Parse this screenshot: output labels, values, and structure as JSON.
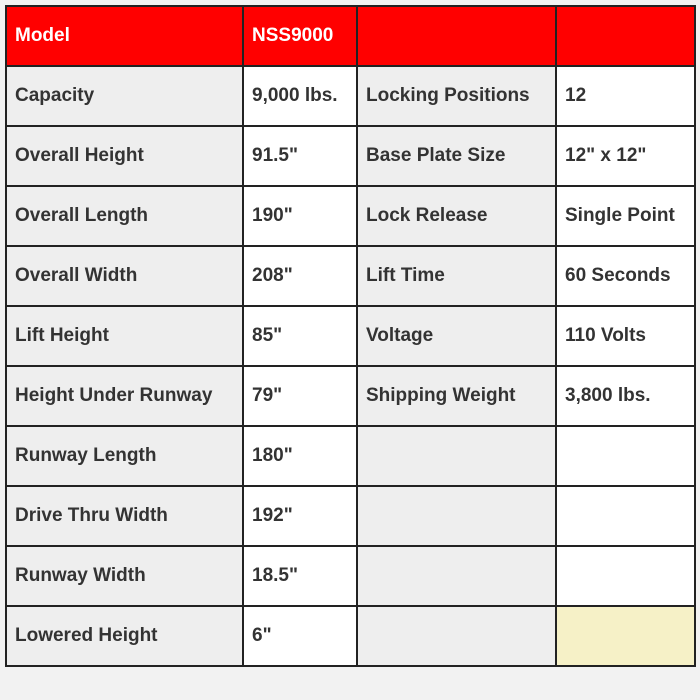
{
  "header": [
    "Model",
    "NSS9000",
    "",
    ""
  ],
  "rows": [
    [
      "Capacity",
      "9,000 lbs.",
      "Locking Positions",
      "12"
    ],
    [
      "Overall Height",
      "91.5\"",
      "Base Plate Size",
      "12\" x 12\""
    ],
    [
      "Overall Length",
      "190\"",
      "Lock Release",
      "Single Point"
    ],
    [
      "Overall Width",
      "208\"",
      "Lift Time",
      "60 Seconds"
    ],
    [
      "Lift Height",
      "85\"",
      "Voltage",
      "110 Volts"
    ],
    [
      "Height Under Runway",
      "79\"",
      "Shipping Weight",
      "3,800 lbs."
    ],
    [
      "Runway Length",
      "180\"",
      "",
      ""
    ],
    [
      "Drive Thru Width",
      "192\"",
      "",
      ""
    ],
    [
      "Runway Width",
      "18.5\"",
      "",
      ""
    ],
    [
      "Lowered Height",
      "6\"",
      "",
      ""
    ]
  ],
  "colors": {
    "header_bg": "#ff0000",
    "label_bg": "#eeeeee",
    "highlight_bg": "#f6f1c7"
  }
}
